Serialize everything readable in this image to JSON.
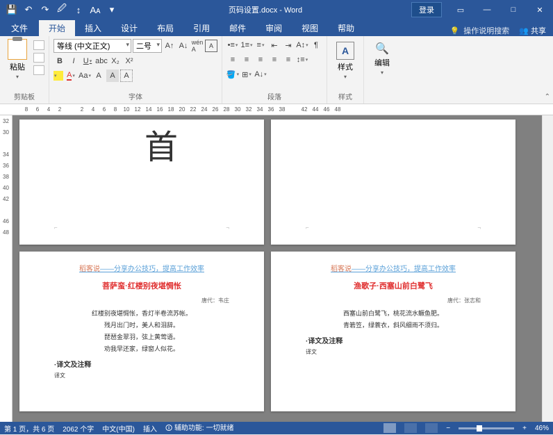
{
  "qat": {
    "save": "💾",
    "undo": "↶",
    "redo": "↷",
    "more": "⋯"
  },
  "title": "页码设置.docx - Word",
  "login": "登录",
  "tabs": {
    "file": "文件",
    "home": "开始",
    "insert": "插入",
    "design": "设计",
    "layout": "布局",
    "references": "引用",
    "mailings": "邮件",
    "review": "审阅",
    "view": "视图",
    "help": "帮助",
    "tellme": "操作说明搜索",
    "share": "共享"
  },
  "ribbon": {
    "clipboard": {
      "label": "剪贴板",
      "paste": "粘贴"
    },
    "font": {
      "label": "字体",
      "name": "等线 (中文正文)",
      "size": "二号"
    },
    "paragraph": {
      "label": "段落"
    },
    "styles": {
      "label": "样式",
      "btn": "样式"
    },
    "editing": {
      "label": "",
      "btn": "编辑"
    }
  },
  "ruler_h": [
    "8",
    "6",
    "4",
    "2",
    "",
    "2",
    "4",
    "6",
    "8",
    "10",
    "12",
    "14",
    "16",
    "18",
    "20",
    "22",
    "24",
    "26",
    "28",
    "30",
    "32",
    "34",
    "36",
    "38",
    "",
    "42",
    "44",
    "46",
    "48"
  ],
  "ruler_v": [
    "32",
    "30",
    "",
    "34",
    "36",
    "38",
    "40",
    "42",
    "",
    "46",
    "48"
  ],
  "pages": {
    "p1": {
      "big": "首"
    },
    "p3": {
      "header_brand": "稻客说",
      "header_rest": "——分享办公技巧，提高工作效率",
      "title": "菩萨蛮·红楼别夜堪惆怅",
      "meta": "唐代：韦庄",
      "lines": [
        "红楼别夜堪惆怅，香灯半卷流苏帐。",
        "残月出门时，美人和泪辞。",
        "琵琶金翠羽，弦上黄莺语。",
        "劝我早还家，绿窗人似花。"
      ],
      "section": "·译文及注释",
      "sub": "译文"
    },
    "p4": {
      "header_brand": "稻客说",
      "header_rest": "——分享办公技巧，提高工作效率",
      "title": "渔歌子·西塞山前白鹭飞",
      "meta": "唐代：张志和",
      "lines": [
        "西塞山前白鹭飞，桃花流水鳜鱼肥。",
        "青箬笠，绿蓑衣，斜风细雨不须归。"
      ],
      "section": "·译文及注释",
      "sub": "译文"
    }
  },
  "status": {
    "page": "第 1 页，共 6 页",
    "words": "2062 个字",
    "lang": "中文(中国)",
    "mode": "插入",
    "acc": "辅助功能: 一切就绪",
    "zoom": "46%"
  }
}
